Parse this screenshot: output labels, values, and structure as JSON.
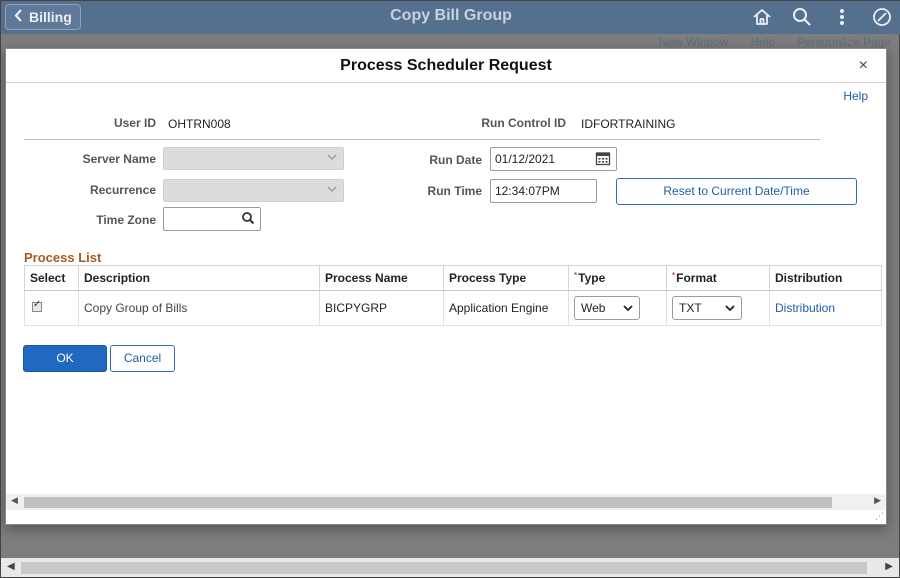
{
  "banner": {
    "back_label": "Billing",
    "title": "Copy Bill Group",
    "icons": [
      "home-icon",
      "search-icon",
      "more-vertical-icon",
      "nav-bar-icon"
    ]
  },
  "subnav": {
    "new_window": "New Window",
    "help": "Help",
    "personalize": "Personalize Page",
    "separator": "|"
  },
  "modal": {
    "title": "Process Scheduler Request",
    "close": "×",
    "help_link": "Help"
  },
  "form": {
    "user_id_label": "User ID",
    "user_id_value": "OHTRN008",
    "run_control_label": "Run Control ID",
    "run_control_value": "IDFORTRAINING",
    "server_name_label": "Server Name",
    "recurrence_label": "Recurrence",
    "time_zone_label": "Time Zone",
    "run_date_label": "Run Date",
    "run_date_value": "01/12/2021",
    "run_time_label": "Run Time",
    "run_time_value": "12:34:07PM",
    "reset_button": "Reset to Current Date/Time"
  },
  "process_list": {
    "title": "Process List",
    "columns": [
      "Select",
      "Description",
      "Process Name",
      "Process Type",
      "Type",
      "Format",
      "Distribution"
    ],
    "required_marker": "*",
    "rows": [
      {
        "selected": true,
        "description": "Copy Group of Bills",
        "process_name": "BICPYGRP",
        "process_type": "Application Engine",
        "type": "Web",
        "format": "TXT",
        "distribution": "Distribution"
      }
    ]
  },
  "actions": {
    "ok": "OK",
    "cancel": "Cancel"
  },
  "colors": {
    "banner": "#55708f",
    "primary_button": "#2168c1",
    "link": "#1f5fa6",
    "section_title": "#a55b24"
  }
}
